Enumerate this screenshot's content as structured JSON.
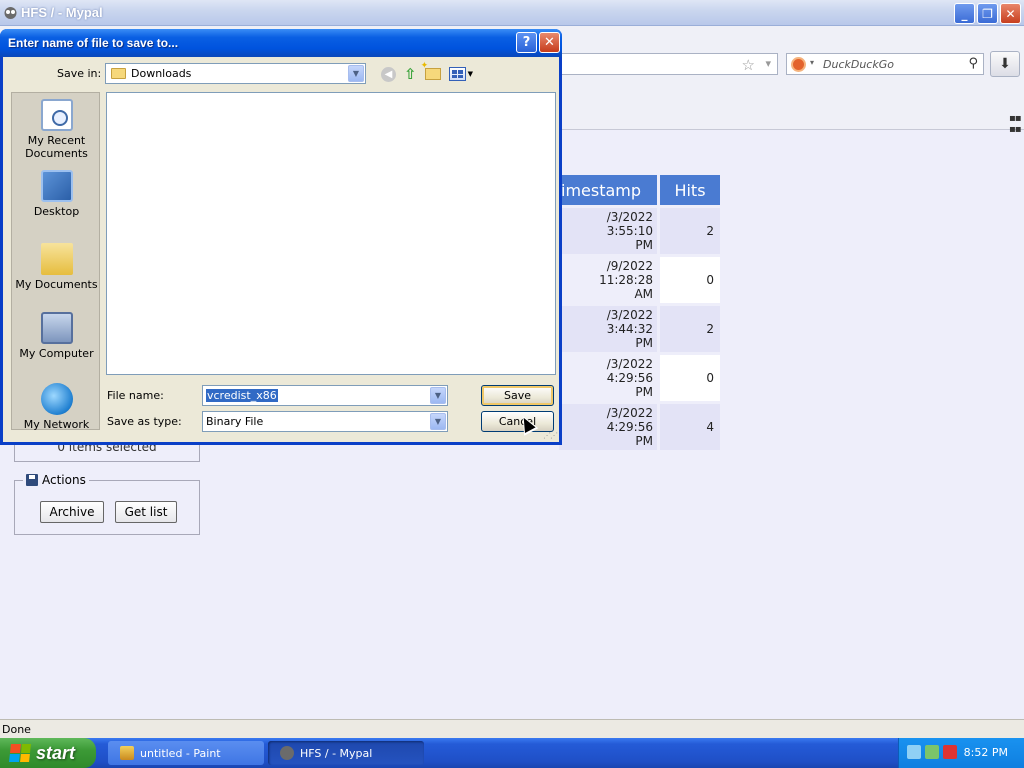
{
  "window": {
    "title": "HFS / - Mypal",
    "minimize": "_",
    "restore": "❐",
    "close": "✕"
  },
  "search": {
    "placeholder": "DuckDuckGo"
  },
  "table": {
    "headers": {
      "timestamp": "imestamp",
      "hits": "Hits"
    },
    "rows": [
      {
        "timestamp_line1": "/3/2022 3:55:10",
        "timestamp_line2": "PM",
        "hits": "2"
      },
      {
        "timestamp_line1": "/9/2022 11:28:28",
        "timestamp_line2": "AM",
        "hits": "0"
      },
      {
        "timestamp_line1": "/3/2022 3:44:32",
        "timestamp_line2": "PM",
        "hits": "2"
      },
      {
        "timestamp_line1": "/3/2022 4:29:56",
        "timestamp_line2": "PM",
        "hits": "0"
      },
      {
        "timestamp_line1": "/3/2022 4:29:56",
        "timestamp_line2": "PM",
        "hits": "4"
      }
    ]
  },
  "selection": {
    "text": "0 items selected"
  },
  "actions": {
    "legend": "Actions",
    "archive": "Archive",
    "get_list": "Get list"
  },
  "status": {
    "text": "Done"
  },
  "dialog": {
    "title": "Enter name of file to save to...",
    "help": "?",
    "close": "✕",
    "save_in_label": "Save in:",
    "save_in_value": "Downloads",
    "places": [
      {
        "label": "My Recent Documents",
        "icon": "recent-documents-icon"
      },
      {
        "label": "Desktop",
        "icon": "desktop-icon"
      },
      {
        "label": "My Documents",
        "icon": "my-documents-icon"
      },
      {
        "label": "My Computer",
        "icon": "my-computer-icon"
      },
      {
        "label": "My Network",
        "icon": "my-network-icon"
      }
    ],
    "file_name_label": "File name:",
    "file_name_value": "vcredist_x86",
    "save_type_label": "Save as type:",
    "save_type_value": "Binary File",
    "save_button": "Save",
    "cancel_button": "Cancel"
  },
  "taskbar": {
    "start": "start",
    "tasks": [
      {
        "label": "untitled - Paint"
      },
      {
        "label": "HFS / - Mypal"
      }
    ],
    "clock": "8:52 PM"
  },
  "colors": {
    "dialog_title_blue": "#0053de",
    "table_header_blue": "#4a7bd2",
    "taskbar_blue": "#245bd7",
    "start_green": "#3c9a36"
  }
}
